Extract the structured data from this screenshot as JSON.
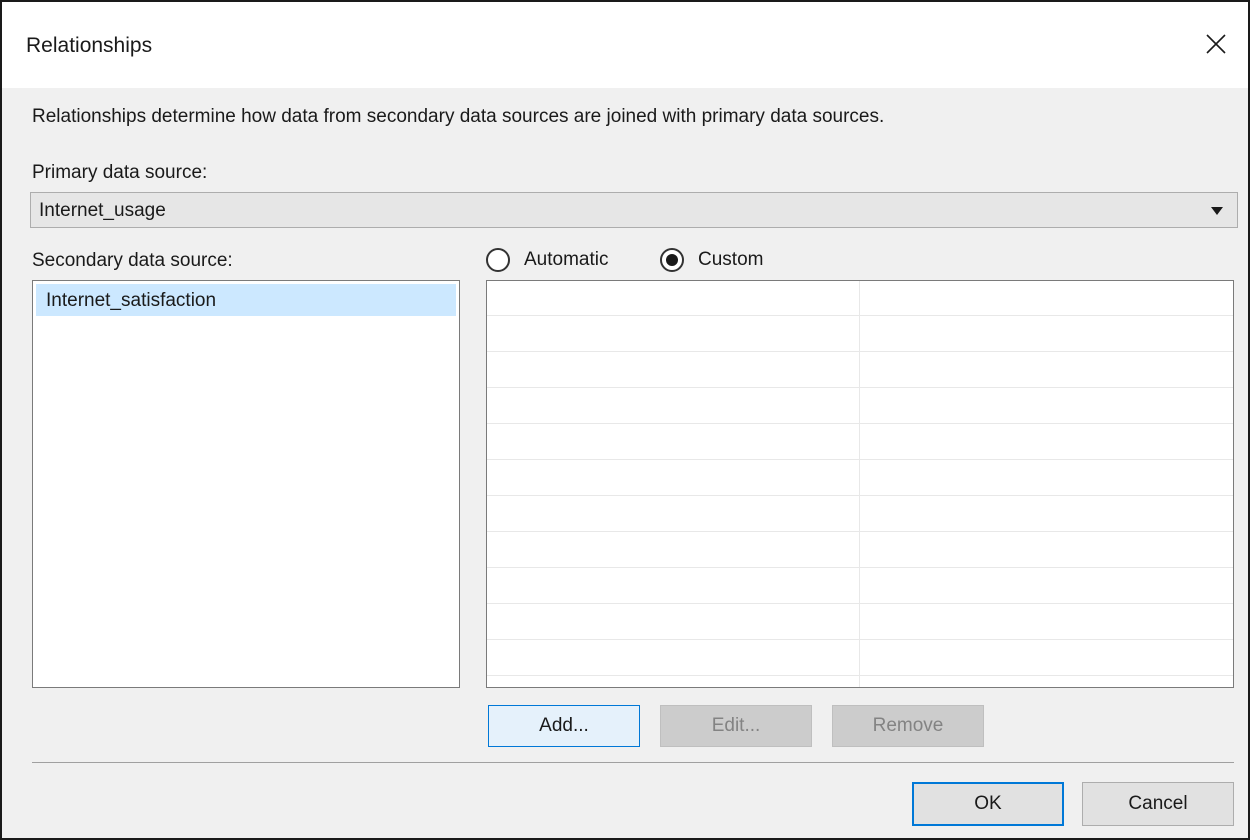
{
  "window": {
    "title": "Relationships",
    "close_icon": "close-icon"
  },
  "description": "Relationships determine how data from secondary data sources are joined with primary data sources.",
  "primary": {
    "label": "Primary data source:",
    "selected": "Internet_usage"
  },
  "secondary": {
    "label": "Secondary data source:",
    "items": [
      {
        "label": "Internet_satisfaction",
        "selected": true
      }
    ]
  },
  "mode": {
    "automatic_label": "Automatic",
    "custom_label": "Custom",
    "selected": "Custom"
  },
  "buttons": {
    "add": "Add...",
    "edit": "Edit...",
    "remove": "Remove",
    "ok": "OK",
    "cancel": "Cancel"
  },
  "colors": {
    "accent": "#0078d7",
    "selection": "#cce8ff",
    "dialog_bg": "#f0f0f0"
  }
}
